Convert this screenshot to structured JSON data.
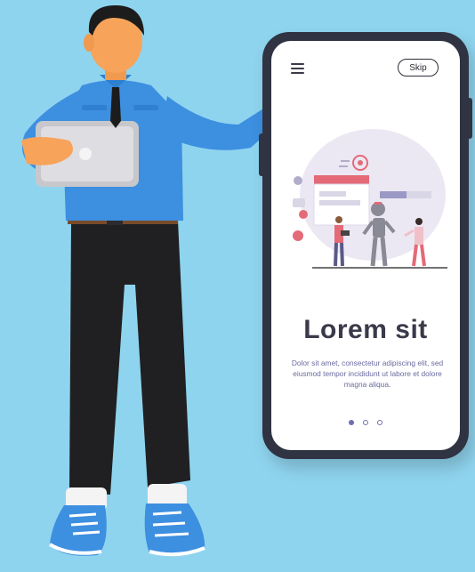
{
  "onboarding": {
    "skip_label": "Skip",
    "headline": "Lorem sit",
    "body": "Dolor sit amet, consectetur adipiscing elit, sed eiusmod tempor incididunt ut labore et dolore magna aliqua.",
    "pagination": {
      "total": 3,
      "current": 1
    }
  },
  "icons": [
    "menu-icon"
  ],
  "colors": {
    "background": "#8fd4ee",
    "phone_frame": "#2f3342",
    "headline": "#3a3a4a",
    "body_text": "#6a6aa0",
    "dot": "#6e6eb0",
    "shirt": "#3d8fe0",
    "pants": "#222222"
  }
}
